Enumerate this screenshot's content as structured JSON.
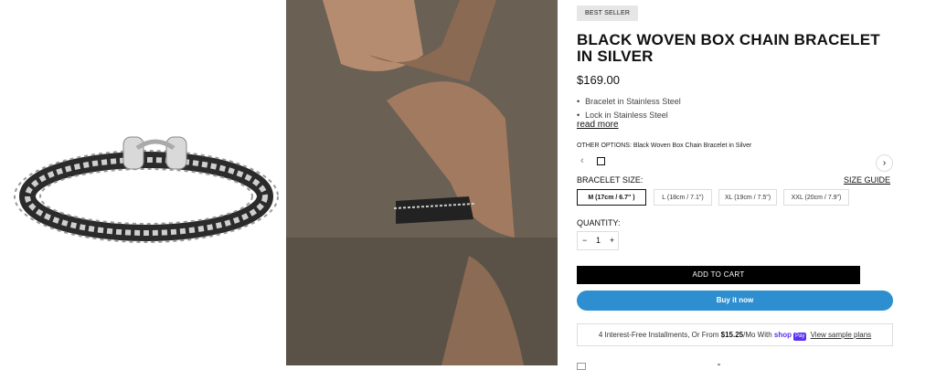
{
  "product": {
    "badge": "BEST SELLER",
    "title": "BLACK WOVEN BOX CHAIN BRACELET IN SILVER",
    "price": "$169.00",
    "bullets": [
      "Bracelet in Stainless Steel",
      "Lock in Stainless Steel"
    ],
    "read_more": "read more"
  },
  "options": {
    "label": "OTHER OPTIONS:",
    "value": "Black Woven Box Chain Bracelet in Silver",
    "prev_icon": "chevron-left-icon",
    "next_icon": "chevron-right-icon"
  },
  "size": {
    "label": "BRACELET SIZE:",
    "guide": "SIZE GUIDE",
    "items": [
      {
        "label": "M (17cm / 6.7\" )",
        "selected": true
      },
      {
        "label": "L (18cm / 7.1\")",
        "selected": false
      },
      {
        "label": "XL (19cm / 7.5\")",
        "selected": false
      },
      {
        "label": "XXL (20cm / 7.9\")",
        "selected": false
      }
    ]
  },
  "quantity": {
    "label": "QUANTITY:",
    "minus": "−",
    "value": "1",
    "plus": "+"
  },
  "actions": {
    "add_to_cart": "ADD TO CART",
    "buy_now": "Buy it now"
  },
  "installments": {
    "prefix": "4 Interest-Free Installments, Or From",
    "amount": "$15.25",
    "suffix": "/Mo With",
    "brand": "shop",
    "brand_badge": "Pay",
    "link": "View sample plans"
  },
  "colors": {
    "buy_now_bg": "#2d8fd0",
    "shop_pay": "#5a31f4",
    "add_to_cart_bg": "#000000"
  }
}
